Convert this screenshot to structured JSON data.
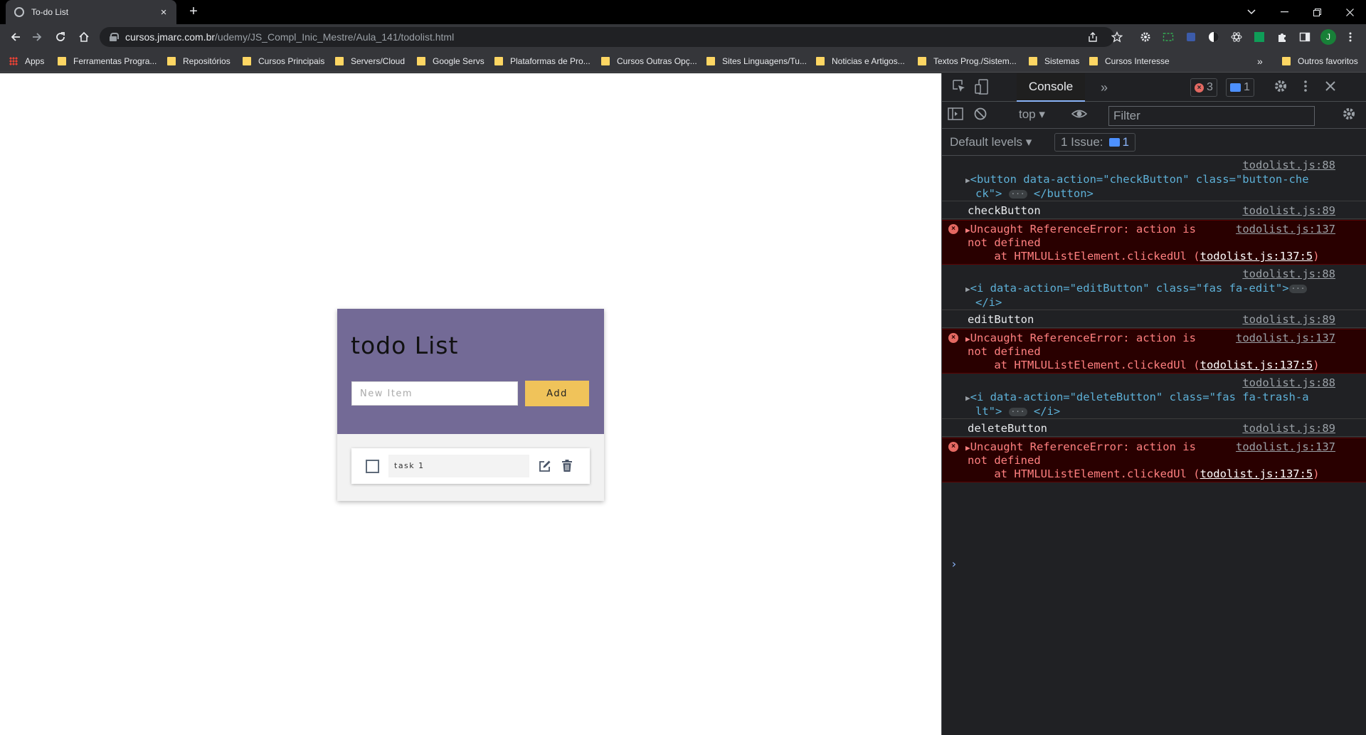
{
  "browser": {
    "tab_title": "To-do List",
    "tab_close": "×",
    "new_tab": "+",
    "url_domain": "cursos.jmarc.com.br",
    "url_path": "/udemy/JS_Compl_Inic_Mestre/Aula_141/todolist.html",
    "profile_initial": "J",
    "bookmarks": [
      "Apps",
      "Ferramentas Progra...",
      "Repositórios",
      "Cursos Principais",
      "Servers/Cloud",
      "Google Servs",
      "Plataformas de Pro...",
      "Cursos Outras Opç...",
      "Sites Linguagens/Tu...",
      "Noticias e Artigos...",
      "Textos Prog./Sistem...",
      "Sistemas",
      "Cursos Interesse"
    ],
    "bookmarks_overflow": "»",
    "other_bookmarks": "Outros favoritos"
  },
  "page": {
    "title": "todo List",
    "input_placeholder": "New Item",
    "add_button": "Add",
    "tasks": [
      {
        "text": "task 1",
        "checked": false
      }
    ]
  },
  "devtools": {
    "active_tab": "Console",
    "error_count": "3",
    "message_count": "1",
    "context": "top",
    "filter_placeholder": "Filter",
    "levels": "Default levels",
    "issues_label": "1 Issue:",
    "issues_count": "1",
    "logs": [
      {
        "type": "element",
        "source": "todolist.js:88",
        "line1": "<button data-action=\"checkButton\" class=\"button-che",
        "line2": "ck\">",
        "close": "</button>"
      },
      {
        "type": "log",
        "text": "checkButton",
        "source": "todolist.js:89"
      },
      {
        "type": "error",
        "text1": "Uncaught ReferenceError: action is",
        "text2": "not defined",
        "stack_prefix": "    at HTMLUListElement.clickedUl (",
        "stack_link": "todolist.js:137:5",
        "stack_suffix": ")",
        "source": "todolist.js:137"
      },
      {
        "type": "element",
        "source": "todolist.js:88",
        "line1": "<i data-action=\"editButton\" class=\"fas fa-edit\">",
        "line2": "",
        "close": "</i>"
      },
      {
        "type": "log",
        "text": "editButton",
        "source": "todolist.js:89"
      },
      {
        "type": "error",
        "text1": "Uncaught ReferenceError: action is",
        "text2": "not defined",
        "stack_prefix": "    at HTMLUListElement.clickedUl (",
        "stack_link": "todolist.js:137:5",
        "stack_suffix": ")",
        "source": "todolist.js:137"
      },
      {
        "type": "element",
        "source": "todolist.js:88",
        "line1": "<i data-action=\"deleteButton\" class=\"fas fa-trash-a",
        "line2": "lt\">",
        "close": "</i>"
      },
      {
        "type": "log",
        "text": "deleteButton",
        "source": "todolist.js:89"
      },
      {
        "type": "error",
        "text1": "Uncaught ReferenceError: action is",
        "text2": "not defined",
        "stack_prefix": "    at HTMLUListElement.clickedUl (",
        "stack_link": "todolist.js:137:5",
        "stack_suffix": ")",
        "source": "todolist.js:137"
      }
    ],
    "prompt": "›"
  },
  "colors": {
    "header_purple": "#736a96",
    "add_button_yellow": "#f0c35a",
    "error_red": "#e46962",
    "console_accent": "#8ab4f8"
  }
}
